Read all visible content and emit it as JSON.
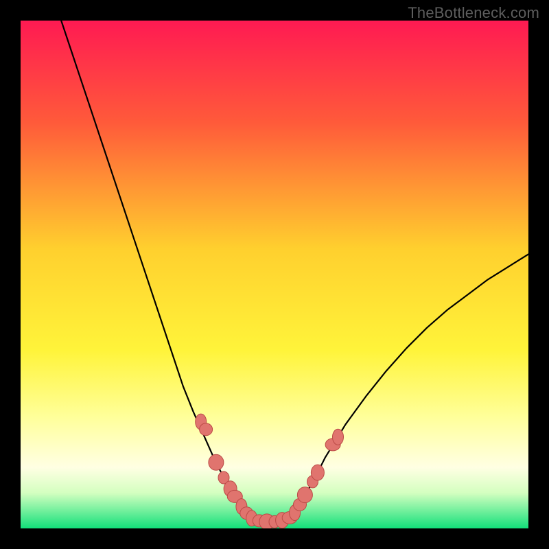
{
  "watermark": "TheBottleneck.com",
  "chart_data": {
    "type": "line",
    "title": "",
    "xlabel": "",
    "ylabel": "",
    "xlim": [
      0,
      100
    ],
    "ylim": [
      0,
      100
    ],
    "background_gradient": {
      "stops": [
        {
          "offset": 0,
          "color": "#ff1a52"
        },
        {
          "offset": 20,
          "color": "#ff5a3a"
        },
        {
          "offset": 45,
          "color": "#ffd02e"
        },
        {
          "offset": 65,
          "color": "#fff43a"
        },
        {
          "offset": 78,
          "color": "#ffff9a"
        },
        {
          "offset": 88,
          "color": "#ffffe3"
        },
        {
          "offset": 93,
          "color": "#d4ffc0"
        },
        {
          "offset": 100,
          "color": "#12e07a"
        }
      ]
    },
    "series": [
      {
        "name": "left-curve",
        "style": "line",
        "x": [
          8,
          10,
          12,
          14,
          16,
          18,
          20,
          22,
          24,
          26,
          28,
          30,
          32,
          34,
          36,
          38,
          40,
          42,
          43,
          44,
          45
        ],
        "y": [
          100,
          94,
          88,
          82,
          76,
          70,
          64,
          58,
          52,
          46,
          40,
          34,
          28,
          23,
          18.5,
          14,
          10,
          6.5,
          4.5,
          3,
          2
        ]
      },
      {
        "name": "flat-bottom",
        "style": "line",
        "x": [
          45,
          47,
          49,
          51,
          53
        ],
        "y": [
          2,
          1.4,
          1.2,
          1.4,
          2
        ]
      },
      {
        "name": "right-curve",
        "style": "line",
        "x": [
          53,
          54,
          55,
          56,
          58,
          60,
          64,
          68,
          72,
          76,
          80,
          84,
          88,
          92,
          96,
          100
        ],
        "y": [
          2,
          3,
          4.5,
          6.5,
          10,
          14,
          20.5,
          26,
          31,
          35.5,
          39.5,
          43,
          46,
          49,
          51.5,
          54
        ]
      },
      {
        "name": "left-markers",
        "style": "scatter",
        "x": [
          35.5,
          36.5,
          38.5,
          40.0,
          41.3,
          42.2,
          43.5,
          44.5
        ],
        "y": [
          21.0,
          19.5,
          13.0,
          10.0,
          7.8,
          6.3,
          4.3,
          3.0
        ]
      },
      {
        "name": "flat-markers",
        "style": "scatter",
        "x": [
          45.5,
          47.0,
          48.5,
          50.0,
          51.5,
          53.0
        ],
        "y": [
          2.0,
          1.5,
          1.3,
          1.3,
          1.6,
          2.1
        ]
      },
      {
        "name": "right-markers",
        "style": "scatter",
        "x": [
          54.0,
          55.0,
          56.0,
          57.5,
          58.5,
          61.5,
          62.5
        ],
        "y": [
          3.1,
          4.7,
          6.6,
          9.2,
          11.0,
          16.5,
          18.0
        ]
      }
    ],
    "marker_color": "#e0746e",
    "marker_edge": "#bb4a46",
    "line_color": "#000000"
  }
}
